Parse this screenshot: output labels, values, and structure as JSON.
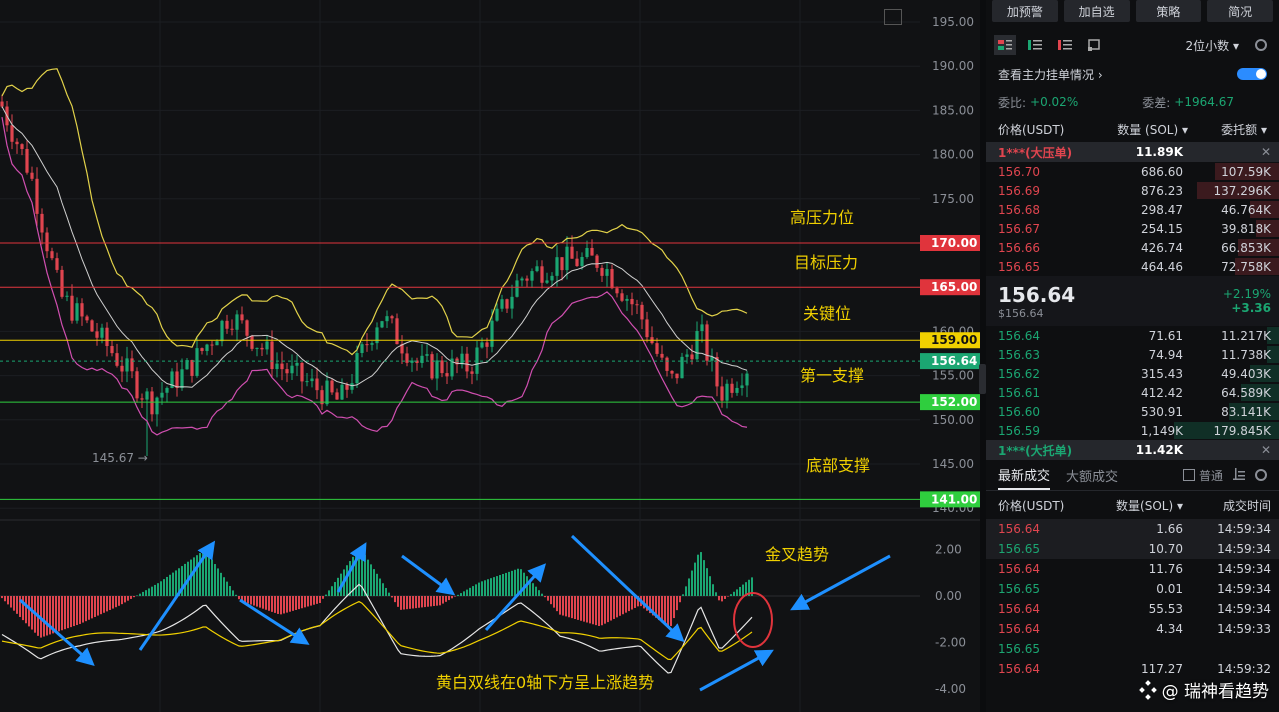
{
  "chart": {
    "y_ticks": [
      "195.00",
      "190.00",
      "185.00",
      "180.00",
      "175.00",
      "170.00",
      "165.00",
      "160.00",
      "155.00",
      "150.00",
      "145.00",
      "140.00"
    ],
    "macd_ticks": [
      "2.00",
      "0.00",
      "-2.00",
      "-4.00"
    ],
    "levels": [
      {
        "price": 170,
        "tag": "170.00",
        "color": "#e0343c"
      },
      {
        "price": 165,
        "tag": "165.00",
        "color": "#e0343c"
      },
      {
        "price": 159,
        "tag": "159.00",
        "color": "#f0d000"
      },
      {
        "price": 152,
        "tag": "152.00",
        "color": "#2fce3e"
      },
      {
        "price": 141,
        "tag": "141.00",
        "color": "#2fce3e"
      }
    ],
    "current_price_tag": "156.64",
    "current_price": 156.64,
    "low_marker": "145.67 →",
    "annotations": {
      "high_pressure": "高压力位",
      "target_pressure": "目标压力",
      "key_level": "关键位",
      "first_support": "第一支撑",
      "bottom_support": "底部支撑",
      "golden_cross": "金叉趋势",
      "macd_note": "黄白双线在0轴下方呈上涨趋势"
    },
    "colors": {
      "up": "#1ba672",
      "down": "#e0454f",
      "bb_upper": "#e2d24a",
      "bb_mid": "#cfcfcf",
      "bb_lower": "#d04fb0"
    }
  },
  "toolbar": {
    "buttons": [
      "加预警",
      "加自选",
      "策略",
      "简况"
    ]
  },
  "view": {
    "decimal": "2位小数 ▾"
  },
  "orderbook": {
    "toggle_label": "查看主力挂单情况 ›",
    "ratio_label": "委比:",
    "ratio_value": "+0.02%",
    "diff_label": "委差:",
    "diff_value": "+1964.67",
    "headers": [
      "价格(USDT)",
      "数量 (SOL) ▾",
      "委托额 ▾"
    ],
    "big_ask": {
      "label": "1***(大压单)",
      "qty": "11.89K",
      "close": "✕"
    },
    "asks": [
      {
        "price": "156.70",
        "qty": "686.60",
        "amount": "107.59K",
        "depth": 0.22
      },
      {
        "price": "156.69",
        "qty": "876.23",
        "amount": "137.296K",
        "depth": 0.28
      },
      {
        "price": "156.68",
        "qty": "298.47",
        "amount": "46.764K",
        "depth": 0.1
      },
      {
        "price": "156.67",
        "qty": "254.15",
        "amount": "39.818K",
        "depth": 0.08
      },
      {
        "price": "156.66",
        "qty": "426.74",
        "amount": "66.853K",
        "depth": 0.14
      },
      {
        "price": "156.65",
        "qty": "464.46",
        "amount": "72.758K",
        "depth": 0.15
      }
    ],
    "last_price": "156.64",
    "last_price_sub": "$156.64",
    "change_pct": "+2.19%",
    "change_abs": "+3.36",
    "bids": [
      {
        "price": "156.64",
        "qty": "71.61",
        "amount": "11.217K",
        "depth": 0.04
      },
      {
        "price": "156.63",
        "qty": "74.94",
        "amount": "11.738K",
        "depth": 0.04
      },
      {
        "price": "156.62",
        "qty": "315.43",
        "amount": "49.403K",
        "depth": 0.1
      },
      {
        "price": "156.61",
        "qty": "412.42",
        "amount": "64.589K",
        "depth": 0.13
      },
      {
        "price": "156.60",
        "qty": "530.91",
        "amount": "83.141K",
        "depth": 0.17
      },
      {
        "price": "156.59",
        "qty": "1,149K",
        "amount": "179.845K",
        "depth": 0.36
      }
    ],
    "big_bid": {
      "label": "1***(大托单)",
      "qty": "11.42K",
      "close": "✕"
    }
  },
  "trades": {
    "tabs": [
      "最新成交",
      "大额成交"
    ],
    "normal_label": "普通",
    "headers": [
      "价格(USDT)",
      "数量(SOL) ▾",
      "成交时间"
    ],
    "rows": [
      {
        "price": "156.64",
        "side": "down",
        "qty": "1.66",
        "time": "14:59:34"
      },
      {
        "price": "156.65",
        "side": "up",
        "qty": "10.70",
        "time": "14:59:34"
      },
      {
        "price": "156.64",
        "side": "down",
        "qty": "11.76",
        "time": "14:59:34"
      },
      {
        "price": "156.65",
        "side": "up",
        "qty": "0.01",
        "time": "14:59:34"
      },
      {
        "price": "156.64",
        "side": "down",
        "qty": "55.53",
        "time": "14:59:34"
      },
      {
        "price": "156.64",
        "side": "down",
        "qty": "4.34",
        "time": "14:59:33"
      },
      {
        "price": "156.65",
        "side": "up",
        "qty": "",
        "time": ""
      },
      {
        "price": "156.64",
        "side": "down",
        "qty": "117.27",
        "time": "14:59:32"
      }
    ]
  },
  "watermark": "@ 瑞神看趋势"
}
